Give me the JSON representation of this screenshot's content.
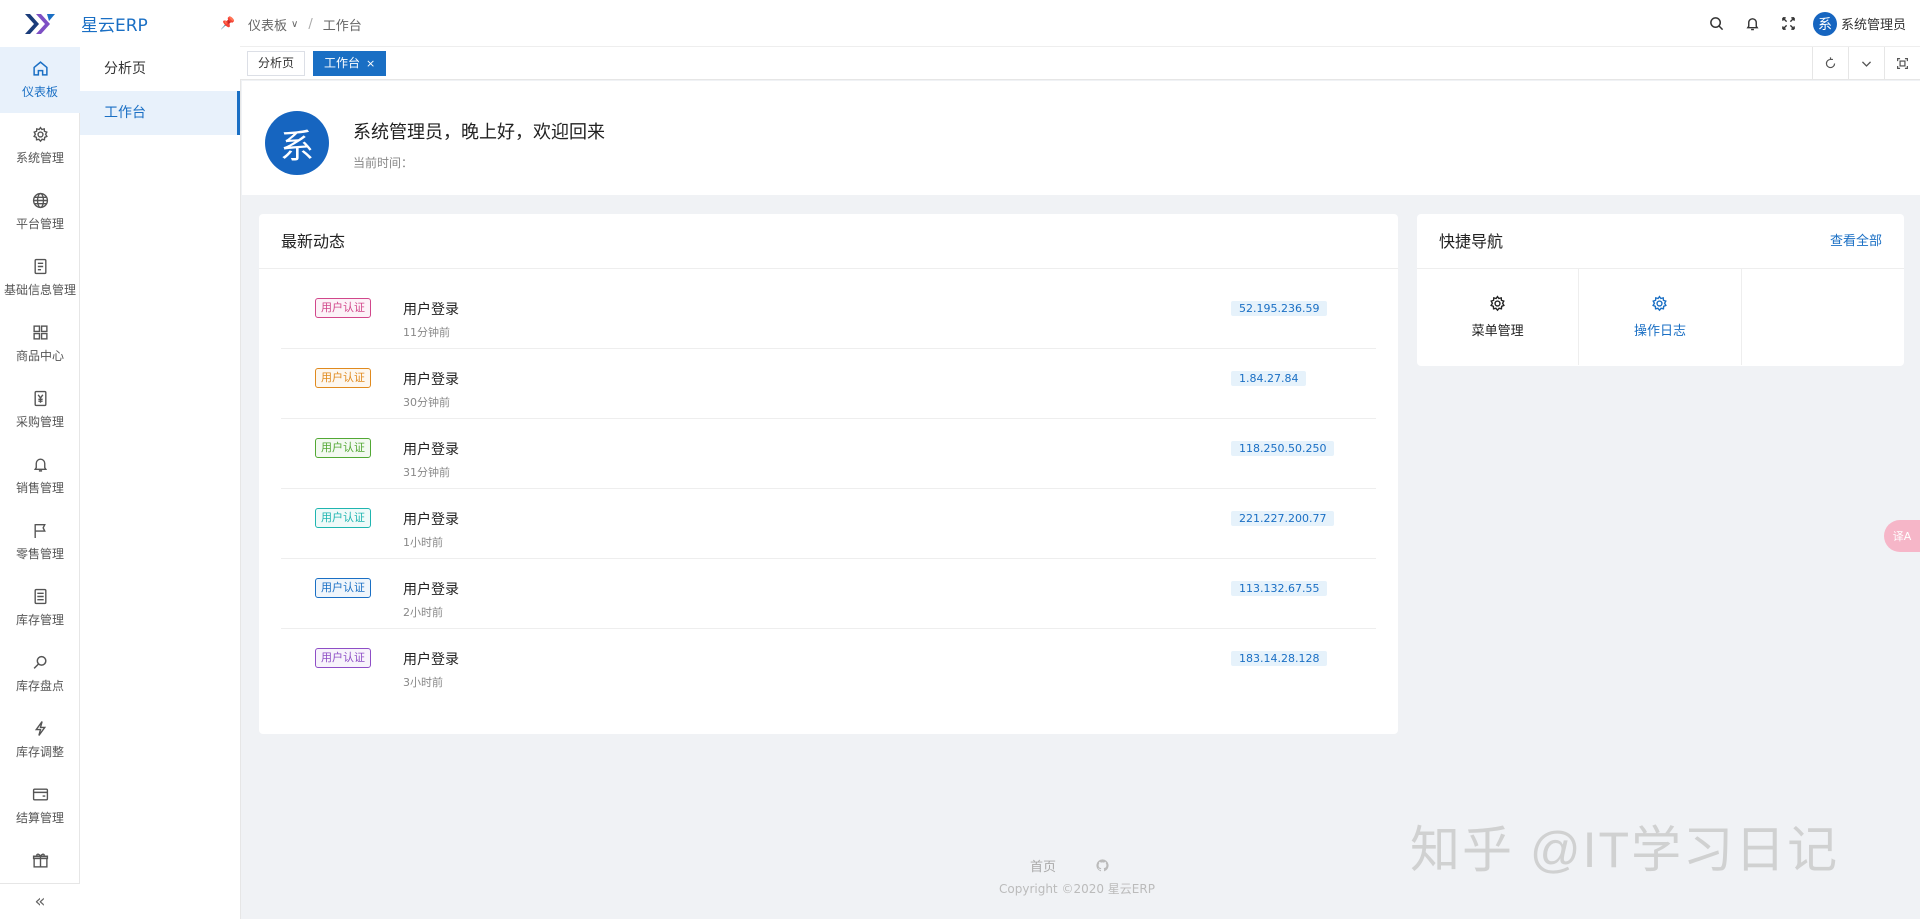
{
  "brand": {
    "name": "星云ERP"
  },
  "rail": {
    "items": [
      {
        "label": "仪表板",
        "icon": "home-icon"
      },
      {
        "label": "系统管理",
        "icon": "gear-icon"
      },
      {
        "label": "平台管理",
        "icon": "globe-icon"
      },
      {
        "label": "基础信息管理",
        "icon": "document-icon"
      },
      {
        "label": "商品中心",
        "icon": "grid-icon"
      },
      {
        "label": "采购管理",
        "icon": "yen-file-icon"
      },
      {
        "label": "销售管理",
        "icon": "bell-icon"
      },
      {
        "label": "零售管理",
        "icon": "flag-icon"
      },
      {
        "label": "库存管理",
        "icon": "list-box-icon"
      },
      {
        "label": "库存盘点",
        "icon": "search-icon"
      },
      {
        "label": "库存调整",
        "icon": "lightning-icon"
      },
      {
        "label": "结算管理",
        "icon": "wallet-icon"
      }
    ]
  },
  "submenu": {
    "items": [
      "分析页",
      "工作台"
    ]
  },
  "header": {
    "breadcrumb": [
      "仪表板",
      "工作台"
    ],
    "user_name": "系统管理员",
    "avatar_char": "系"
  },
  "tabs": [
    {
      "label": "分析页"
    },
    {
      "label": "工作台",
      "close": "×"
    }
  ],
  "welcome": {
    "avatar_char": "系",
    "greeting": "系统管理员，晚上好，欢迎回来",
    "time_label": "当前时间："
  },
  "activity": {
    "title": "最新动态",
    "rows": [
      {
        "tag": "用户认证",
        "tag_color": "#d1478b",
        "title": "用户登录",
        "time": "11分钟前",
        "ip": "52.195.236.59"
      },
      {
        "tag": "用户认证",
        "tag_color": "#e08a1e",
        "title": "用户登录",
        "time": "30分钟前",
        "ip": "1.84.27.84"
      },
      {
        "tag": "用户认证",
        "tag_color": "#52a834",
        "title": "用户登录",
        "time": "31分钟前",
        "ip": "118.250.50.250"
      },
      {
        "tag": "用户认证",
        "tag_color": "#1fb5b0",
        "title": "用户登录",
        "time": "1小时前",
        "ip": "221.227.200.77"
      },
      {
        "tag": "用户认证",
        "tag_color": "#1a6fc4",
        "title": "用户登录",
        "time": "2小时前",
        "ip": "113.132.67.55"
      },
      {
        "tag": "用户认证",
        "tag_color": "#8e4ec6",
        "title": "用户登录",
        "time": "3小时前",
        "ip": "183.14.28.128"
      }
    ]
  },
  "quicknav": {
    "title": "快捷导航",
    "view_all": "查看全部",
    "items": [
      {
        "label": "菜单管理",
        "color": "#222"
      },
      {
        "label": "操作日志",
        "color": "#1a6fc4"
      }
    ]
  },
  "footer": {
    "home_link": "首页",
    "copyright": "Copyright ©2020 星云ERP"
  },
  "watermark": "知乎 @IT学习日记",
  "float_button": "译A"
}
